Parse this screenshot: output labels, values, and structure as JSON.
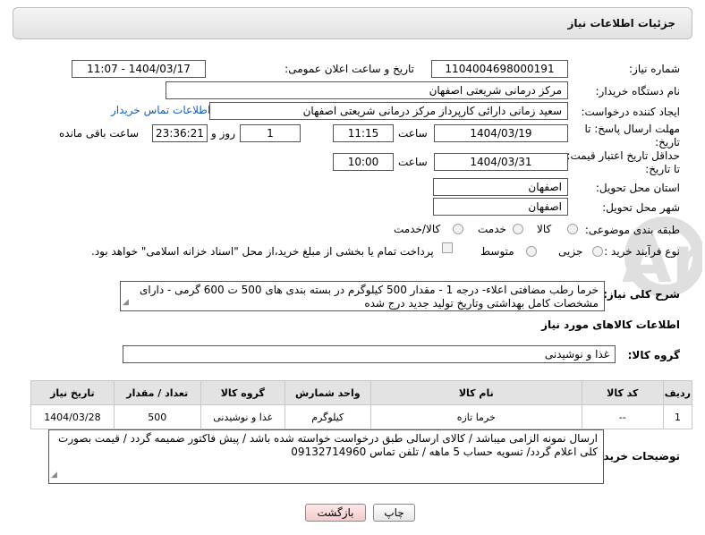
{
  "header": {
    "title": "جزئیات اطلاعات نیاز"
  },
  "labels": {
    "need_number": "شماره نیاز:",
    "announce_datetime": "تاریخ و ساعت اعلان عمومی:",
    "buyer_org": "نام دستگاه خریدار:",
    "creator": "ایجاد کننده درخواست:",
    "reply_deadline": "مهلت ارسال پاسخ: تا تاریخ:",
    "time": "ساعت",
    "days_and": "روز و",
    "remaining": "ساعت باقی مانده",
    "price_validity_1": "حداقل تاریخ اعتبار قیمت:",
    "price_validity_2": "تا تاریخ:",
    "delivery_province": "استان محل تحویل:",
    "delivery_city": "شهر محل تحویل:",
    "category": "طبقه بندی موضوعی:",
    "process_type": "نوع فرآیند خرید :",
    "general_desc": "شرح کلی نیاز:",
    "goods_info": "اطلاعات کالاهای مورد نیاز",
    "goods_group": "گروه کالا:",
    "buyer_notes": "توضیحات خریدار:"
  },
  "values": {
    "need_number": "1104004698000191",
    "announce_datetime": "1404/03/17 - 11:07",
    "buyer_org": "مرکز درمانی شریعتی اصفهان",
    "creator": "سعید زمانی دارائی کارپرداز مرکز درمانی شریعتی اصفهان",
    "contact_link": "اطلاعات تماس خریدار",
    "reply_date": "1404/03/19",
    "reply_time": "11:15",
    "days": "1",
    "remaining_time": "23:36:21",
    "validity_date": "1404/03/31",
    "validity_time": "10:00",
    "province": "اصفهان",
    "city": "اصفهان",
    "goods_group": "غذا و نوشیدنی",
    "general_desc": "خرما رطب مضافتی اعلاء- درجه 1 - مقدار 500 کیلوگرم در بسته بندی های 500 ت 600 گرمی - دارای مشخصات کامل بهداشتی وتاریخ تولید جدید درج شده",
    "buyer_notes": "ارسال نمونه الزامی میباشد / کالای ارسالی طبق درخواست خواسته شده باشد / پیش فاکتور ضمیمه گردد / قیمت بصورت کلی اعلام گردد/ تسویه حساب 5 ماهه / تلفن تماس 09132714960"
  },
  "category_options": [
    "کالا",
    "خدمت",
    "کالا/خدمت"
  ],
  "process_options": {
    "partial": "جزیی",
    "medium": "متوسط",
    "payment_note": "پرداخت تمام یا بخشی از مبلغ خرید،از محل \"اسناد خزانه اسلامی\" خواهد بود."
  },
  "table": {
    "headers": [
      "ردیف",
      "کد کالا",
      "نام کالا",
      "واحد شمارش",
      "گروه کالا",
      "تعداد / مقدار",
      "تاریخ نیاز"
    ],
    "rows": [
      [
        "1",
        "--",
        "خرما تازه",
        "کیلوگرم",
        "غذا و نوشیدنی",
        "500",
        "1404/03/28"
      ]
    ]
  },
  "buttons": {
    "print": "چاپ",
    "back": "بازگشت"
  },
  "watermark_text": "AriaTender.neT"
}
